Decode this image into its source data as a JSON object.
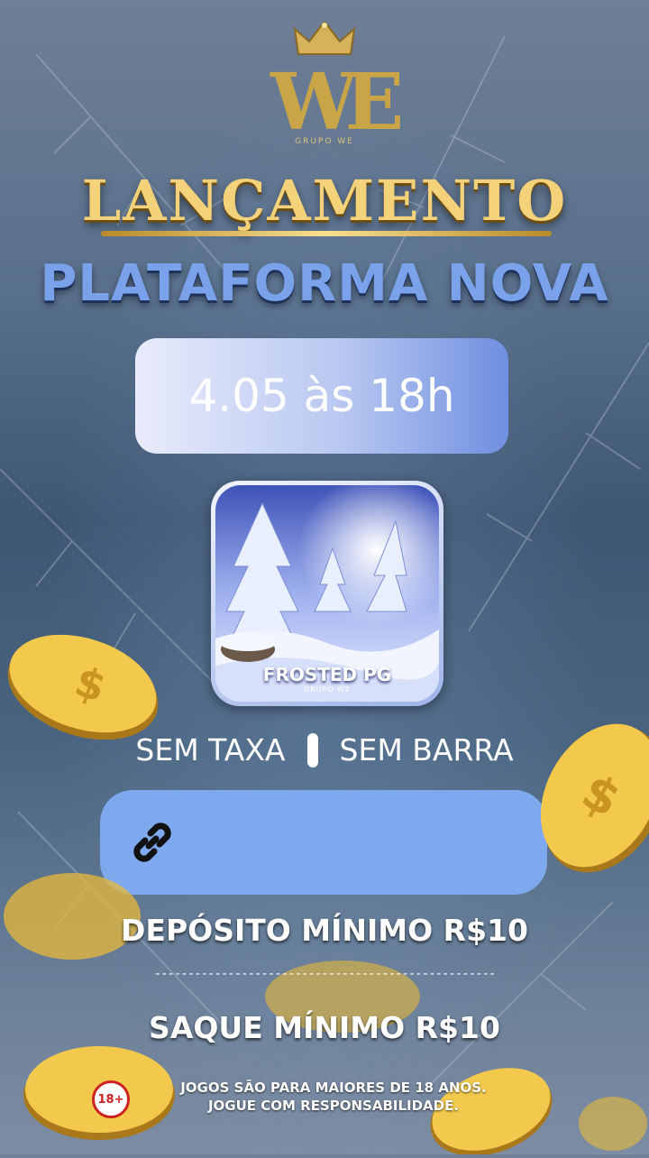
{
  "brand": {
    "logo_letters": "WE",
    "logo_sub": "GRUPO WE"
  },
  "headline": "LANÇAMENTO",
  "subheadline": "PLATAFORMA NOVA",
  "launch_date": "4.05 às 18h",
  "game": {
    "name": "FROSTED PG",
    "sub": "GRUPO WE"
  },
  "tags": {
    "left": "SEM TAXA",
    "right": "SEM BARRA"
  },
  "link_icon": "link-icon",
  "deposit": "DEPÓSITO MÍNIMO R$10",
  "divider": "---------------------------------------------------",
  "withdraw": "SAQUE MÍNIMO R$10",
  "age_badge": "18+",
  "disclaimer_line1": "JOGOS SÃO PARA MAIORES DE 18 ANOS.",
  "disclaimer_line2": "JOGUE COM RESPONSABILIDADE.",
  "colors": {
    "gold": "#f3d27a",
    "blue_title": "#7aa2ea",
    "link_bar": "#7ea9ee"
  }
}
